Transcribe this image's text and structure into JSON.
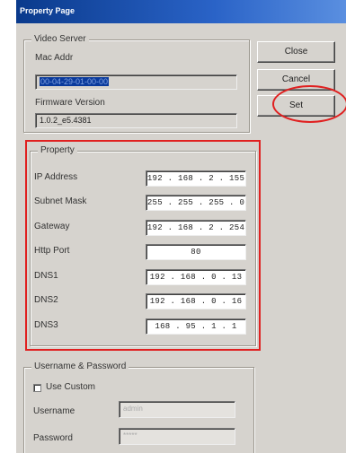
{
  "window": {
    "title": "Property Page"
  },
  "video_server": {
    "legend": "Video Server",
    "mac_label": "Mac Addr",
    "mac_value": "00-04-29-01-00-00",
    "firmware_label": "Firmware Version",
    "firmware_value": "1.0.2_e5.4381"
  },
  "buttons": {
    "close": "Close",
    "cancel": "Cancel",
    "set": "Set"
  },
  "property": {
    "legend": "Property",
    "fields": [
      {
        "label": "IP Address",
        "value": "192 . 168 .  2  . 155"
      },
      {
        "label": "Subnet Mask",
        "value": "255 . 255 . 255 .  0"
      },
      {
        "label": "Gateway",
        "value": "192 . 168 .  2  . 254"
      },
      {
        "label": "Http Port",
        "value": "80"
      },
      {
        "label": "DNS1",
        "value": "192 . 168 .  0  . 13"
      },
      {
        "label": "DNS2",
        "value": "192 . 168 .  0  . 16"
      },
      {
        "label": "DNS3",
        "value": "168 . 95 .  1  .  1"
      }
    ]
  },
  "credentials": {
    "legend": "Username & Password",
    "use_custom_label": "Use Custom",
    "use_custom_checked": false,
    "username_label": "Username",
    "username_value": "admin",
    "password_label": "Password",
    "password_value": "*****"
  },
  "annotation_color": "#e02020"
}
